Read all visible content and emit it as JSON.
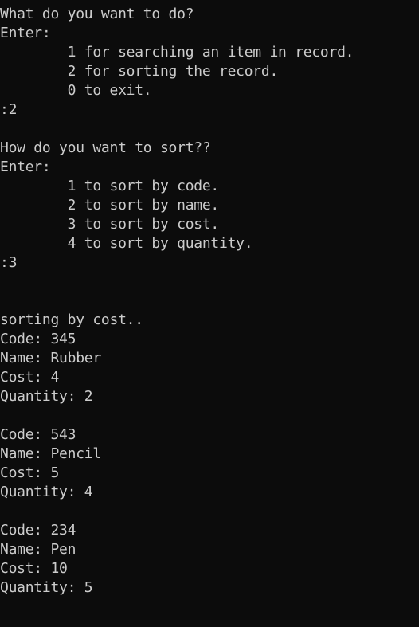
{
  "terminal": {
    "lines": [
      "What do you want to do?",
      "Enter:",
      "        1 for searching an item in record.",
      "        2 for sorting the record.",
      "        0 to exit.",
      ":2",
      "",
      "How do you want to sort??",
      "Enter:",
      "        1 to sort by code.",
      "        2 to sort by name.",
      "        3 to sort by cost.",
      "        4 to sort by quantity.",
      ":3",
      "",
      "",
      "sorting by cost..",
      "Code: 345",
      "Name: Rubber",
      "Cost: 4",
      "Quantity: 2",
      "",
      "Code: 543",
      "Name: Pencil",
      "Cost: 5",
      "Quantity: 4",
      "",
      "Code: 234",
      "Name: Pen",
      "Cost: 10",
      "Quantity: 5"
    ]
  }
}
